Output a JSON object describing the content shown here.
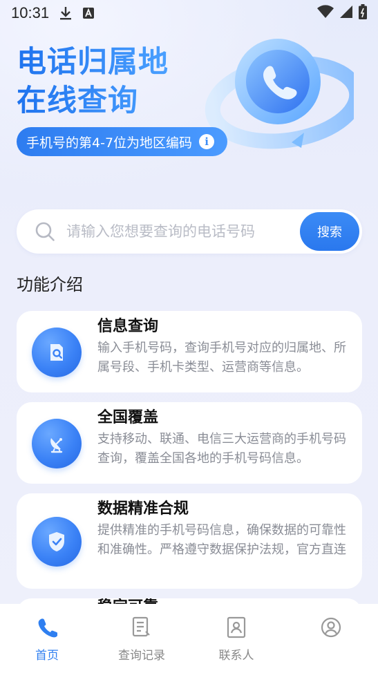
{
  "status_bar": {
    "time": "10:31"
  },
  "hero": {
    "title_line1": "电话归属地",
    "title_line2": "在线查询",
    "pill_text": "手机号的第4-7位为地区编码",
    "pill_info_icon": "i"
  },
  "search": {
    "placeholder": "请输入您想要查询的电话号码",
    "value": "",
    "button_label": "搜索"
  },
  "features": {
    "title": "功能介绍",
    "items": [
      {
        "title": "信息查询",
        "desc": "输入手机号码，查询手机号对应的归属地、所属号段、手机卡类型、运营商等信息。",
        "icon": "document-search-icon"
      },
      {
        "title": "全国覆盖",
        "desc": "支持移动、联通、电信三大运营商的手机号码查询，覆盖全国各地的手机号码信息。",
        "icon": "satellite-dish-icon"
      },
      {
        "title": "数据精准合规",
        "desc": "提供精准的手机号码信息，确保数据的可靠性和准确性。严格遵守数据保护法规，官方直连",
        "icon": "shield-check-icon"
      },
      {
        "title": "稳定可靠",
        "desc": "",
        "icon": "info-icon"
      }
    ]
  },
  "tabbar": {
    "items": [
      {
        "label": "首页",
        "icon": "phone-icon",
        "active": true
      },
      {
        "label": "查询记录",
        "icon": "record-icon",
        "active": false
      },
      {
        "label": "联系人",
        "icon": "contacts-icon",
        "active": false
      },
      {
        "label": "",
        "icon": "profile-icon",
        "active": false
      }
    ]
  },
  "colors": {
    "accent": "#2f7ff0",
    "background": "#eef0fb"
  }
}
